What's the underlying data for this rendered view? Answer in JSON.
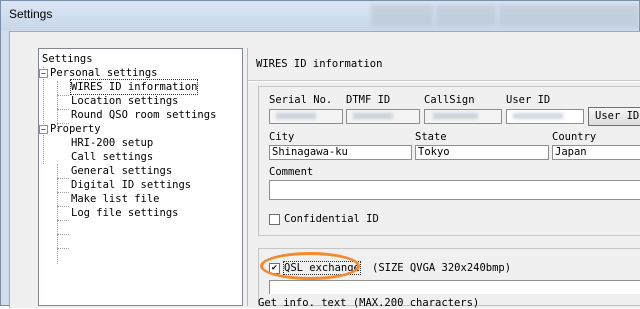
{
  "window": {
    "title": "Settings"
  },
  "tree": {
    "items": [
      {
        "label": "Settings"
      },
      {
        "label": "Personal settings"
      },
      {
        "label": "WIRES ID information"
      },
      {
        "label": "Location settings"
      },
      {
        "label": "Round QSO room settings"
      },
      {
        "label": "Property"
      },
      {
        "label": "HRI-200 setup"
      },
      {
        "label": "Call settings"
      },
      {
        "label": "General settings"
      },
      {
        "label": "Digital ID settings"
      },
      {
        "label": "Make list file"
      },
      {
        "label": "Log file settings"
      }
    ],
    "expander_symbol": "−"
  },
  "panel": {
    "title": "WIRES ID information",
    "labels": {
      "serial": "Serial No.",
      "dtmf": "DTMF ID",
      "callsign": "CallSign",
      "userid": "User ID",
      "city": "City",
      "state": "State",
      "country": "Country",
      "comment": "Comment"
    },
    "values": {
      "city": "Shinagawa-ku",
      "state": "Tokyo",
      "country": "Japan",
      "comment": ""
    },
    "user_id_button": "User ID ch",
    "confidential_label": "Confidential ID",
    "confidential_checked": false,
    "qsl_label": "QSL exchange",
    "qsl_size": "(SIZE QVGA 320x240bmp)",
    "qsl_checked": true,
    "check_mark": "✔",
    "get_info_label": "Get info. text (MAX.200 characters)"
  },
  "colors": {
    "highlight": "#f48a2b"
  }
}
